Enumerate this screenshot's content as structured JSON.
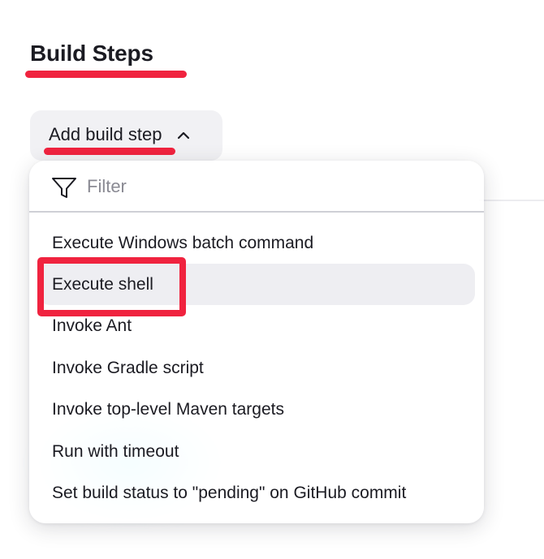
{
  "section": {
    "title": "Build Steps"
  },
  "add_step_button": {
    "label": "Add build step",
    "icon": "chevron-up-icon"
  },
  "dropdown": {
    "filter": {
      "icon": "filter-icon",
      "placeholder": "Filter",
      "value": ""
    },
    "items": [
      {
        "label": "Execute Windows batch command"
      },
      {
        "label": "Execute shell"
      },
      {
        "label": "Invoke Ant"
      },
      {
        "label": "Invoke Gradle script"
      },
      {
        "label": "Invoke top-level Maven targets"
      },
      {
        "label": "Run with timeout"
      },
      {
        "label": "Set build status to \"pending\" on GitHub commit"
      }
    ]
  },
  "colors": {
    "annotation_red": "#f0233f",
    "hover_background": "#eeeef2",
    "button_background": "#f1f1f4",
    "text": "#1b1b22",
    "placeholder": "#8a8a93"
  }
}
